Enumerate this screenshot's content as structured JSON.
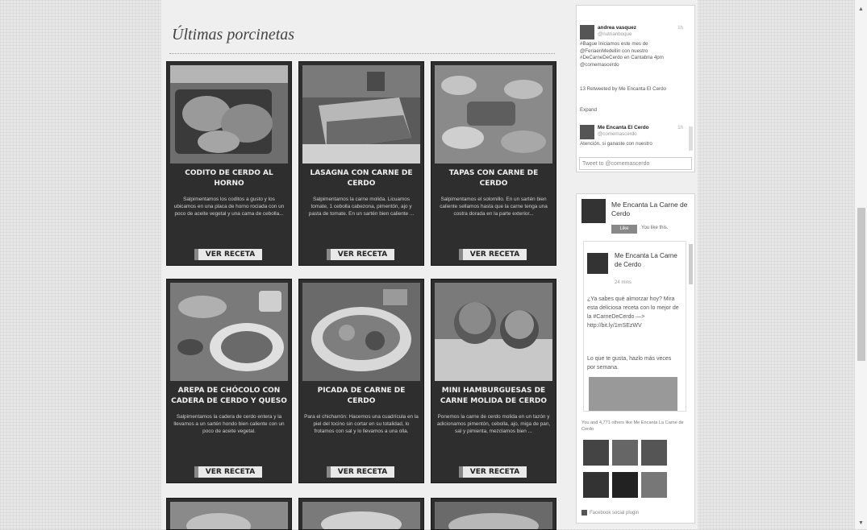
{
  "section_title": "Últimas porcinetas",
  "recipes": [
    {
      "title": "CODITO DE CERDO AL HORNO",
      "desc": "Salpimentamos los coditos a gusto y los ubicamos en una placa de horno rociada con un poco de aceite vegetal y una cama de cebolla...",
      "button": "VER RECETA"
    },
    {
      "title": "LASAGNA CON CARNE DE CERDO",
      "desc": "Salpimentamos la carne molida. Licuamos tomate, 1 cebolla cabezona, pimentón, ajo y pasta de tomate. En un sartén bien caliente ...",
      "button": "VER RECETA"
    },
    {
      "title": "TAPAS CON CARNE DE CERDO",
      "desc": "Salpimentamos el solomillo. En un sartén bien caliente sellamos hasta que la carne tenga una costra dorada en la parte exterior...",
      "button": "VER RECETA"
    },
    {
      "title": "AREPA DE CHÓCOLO CON CADERA DE CERDO Y QUESO",
      "desc": "Salpimentamos la cadera de cerdo entera y la llevamos a un sartén hondo bien caliente con un poco de aceite vegetal.",
      "button": "VER RECETA"
    },
    {
      "title": "PICADA DE CARNE DE CERDO",
      "desc": "Para el chicharrón: Hacemos una cuadrícula en la piel del tocino sin cortar en su totalidad, lo frotamos con sal y lo llevamos a una olla.",
      "button": "VER RECETA"
    },
    {
      "title": "MINI HAMBURGUESAS DE CARNE MOLIDA DE CERDO",
      "desc": "Ponemos la carne de cerdo molida en un tazón y adicionamos pimentón, cebolla, ajo, miga de pan, sal y pimienta, mezclamos bien ...",
      "button": "VER RECETA"
    }
  ],
  "twitter": {
    "tweets": [
      {
        "name": "andrea vasquez",
        "handle": "@nutrianboque",
        "time": "1h",
        "text": "#Bague Iniciamos este mes de @FeriaenMedellin con nuestro #DeCarneDeCerdo en Cantabria 4pm @comemascerdo",
        "retweet": "13 Retweeted by Me Encanta El Cerdo",
        "expand": "Expand"
      },
      {
        "name": "Me Encanta El Cerdo",
        "handle": "@comemascerdo",
        "time": "1h",
        "text": "Atención, si ganaste con nuestro"
      }
    ],
    "input_placeholder": "Tweet to @comemascerdo"
  },
  "facebook": {
    "page_name": "Me Encanta La Carne de Cerdo",
    "like_button": "Like",
    "like_note": "You like this.",
    "post_page": "Me Encanta La Carne de Cerdo",
    "post_time": "24 mins",
    "post_text": "¿Ya sabes qué almorzar hoy? Mira esta deliciosa receta con lo mejor de la #CarneDeCerdo —> http://bit.ly/1mSEzWV",
    "post_text2": "Lo que te gusta, hazlo más veces por semana.",
    "fans_text": "You and 4,771 others like Me Encanta La Carne de Cerdo",
    "plugin_text": "Facebook social plugin"
  }
}
